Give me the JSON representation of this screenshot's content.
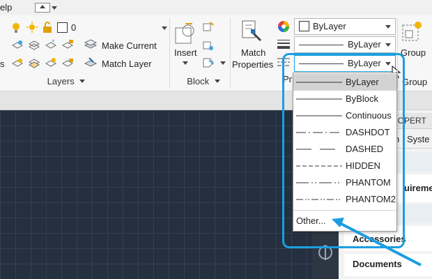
{
  "topbar": {
    "menu_fragment": "elp"
  },
  "layers": {
    "layer_name": "0",
    "make_current": "Make Current",
    "match_layer": "Match Layer",
    "panel_label": "Layers",
    "left_fragment": "s"
  },
  "block": {
    "insert_label": "Insert",
    "panel_label": "Block"
  },
  "properties": {
    "match_label_1": "Match",
    "match_label_2": "Properties",
    "color_value": "ByLayer",
    "linetype_value": "ByLayer",
    "lineweight_value": "ByLayer",
    "panel_fragment": "Pr"
  },
  "groups": {
    "group_label": "Group",
    "panel_label": "Group"
  },
  "right_panel": {
    "header_fragment": "ROPERT",
    "tab_fragment_1": "n",
    "tab_fragment_2": "Syste",
    "row_requirements": "uireme",
    "row_accessories": "Accessories",
    "row_documents": "Documents"
  },
  "linetype_dropdown": {
    "items": [
      {
        "label": "ByLayer",
        "selected": true
      },
      {
        "label": "ByBlock"
      },
      {
        "label": "Continuous"
      },
      {
        "label": "DASHDOT"
      },
      {
        "label": "DASHED"
      },
      {
        "label": "HIDDEN"
      },
      {
        "label": "PHANTOM"
      },
      {
        "label": "PHANTOM2"
      }
    ],
    "other_label": "Other..."
  },
  "colors": {
    "highlight": "#1a9ee0",
    "canvas": "#243040",
    "bulb": "#f2b500"
  }
}
